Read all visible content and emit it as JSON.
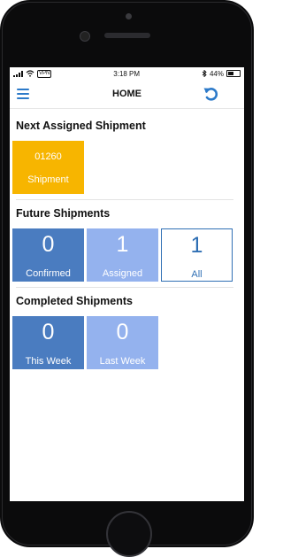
{
  "status_bar": {
    "vpn": "VPN",
    "time": "3:18 PM",
    "battery": "44%"
  },
  "navbar": {
    "title": "HOME"
  },
  "next_assigned": {
    "title": "Next Assigned Shipment",
    "tile": {
      "number": "01260",
      "label": "Shipment"
    }
  },
  "future": {
    "title": "Future Shipments",
    "tiles": [
      {
        "number": "0",
        "label": "Confirmed"
      },
      {
        "number": "1",
        "label": "Assigned"
      },
      {
        "number": "1",
        "label": "All"
      }
    ]
  },
  "completed": {
    "title": "Completed Shipments",
    "tiles": [
      {
        "number": "0",
        "label": "This Week"
      },
      {
        "number": "0",
        "label": "Last Week"
      }
    ]
  },
  "colors": {
    "accent": "#2c7ac9",
    "next_tile": "#f7b500",
    "confirmed_tile": "#4a7cc0",
    "assigned_tile": "#94b2ee",
    "all_tile_border": "#2f6fb4"
  }
}
